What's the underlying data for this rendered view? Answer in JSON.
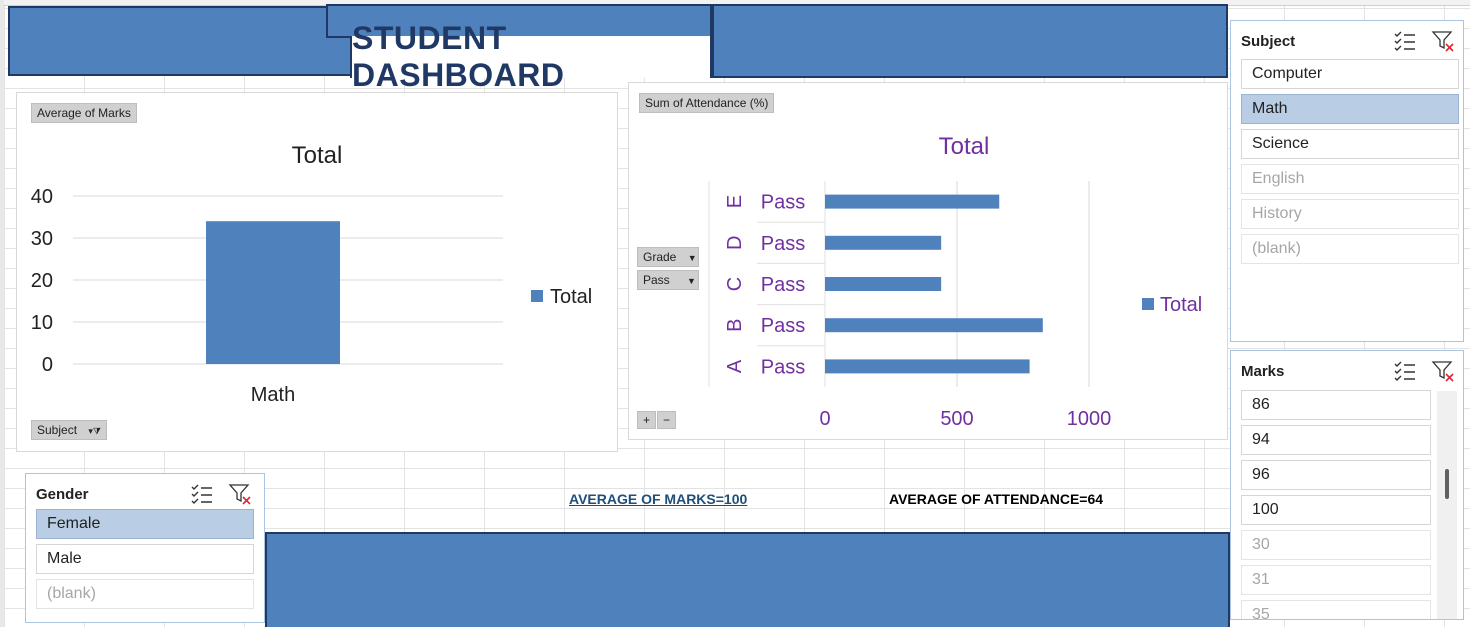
{
  "dashboard": {
    "title": "STUDENT DASHBOARD",
    "avg_marks_label": "AVERAGE OF MARKS=100",
    "avg_attendance_label": "AVERAGE OF ATTENDANCE=64"
  },
  "colors": {
    "banner": "#4f81bd",
    "banner_border": "#1f3864",
    "bar": "#4f81bd",
    "purple_text": "#7030a0",
    "slicer_selected": "#b9cde5"
  },
  "chart_data": [
    {
      "type": "bar",
      "field_button": "Average of Marks",
      "axis_field_button": "Subject",
      "title": "Total",
      "categories": [
        "Math"
      ],
      "series": [
        {
          "name": "Total",
          "values": [
            34
          ]
        }
      ],
      "ylim": [
        0,
        40
      ],
      "yticks": [
        0,
        10,
        20,
        30,
        40
      ],
      "grid": true,
      "legend": "right"
    },
    {
      "type": "bar",
      "orientation": "horizontal",
      "field_button": "Sum of Attendance (%)",
      "row_field_buttons": [
        "Grade",
        "Pass"
      ],
      "title": "Total",
      "categories": [
        {
          "grade": "E",
          "pass": "Pass"
        },
        {
          "grade": "D",
          "pass": "Pass"
        },
        {
          "grade": "C",
          "pass": "Pass"
        },
        {
          "grade": "B",
          "pass": "Pass"
        },
        {
          "grade": "A",
          "pass": "Pass"
        }
      ],
      "series": [
        {
          "name": "Total",
          "values": [
            660,
            440,
            440,
            825,
            775
          ]
        }
      ],
      "xlim": [
        0,
        1000
      ],
      "xticks": [
        0,
        500,
        1000
      ],
      "grid": true,
      "legend": "right",
      "expand_buttons": [
        "+",
        "−"
      ]
    }
  ],
  "slicers": {
    "subject": {
      "title": "Subject",
      "items": [
        {
          "label": "Computer",
          "state": "normal"
        },
        {
          "label": "Math",
          "state": "selected"
        },
        {
          "label": "Science",
          "state": "normal"
        },
        {
          "label": "English",
          "state": "dim"
        },
        {
          "label": "History",
          "state": "dim"
        },
        {
          "label": "(blank)",
          "state": "dim"
        }
      ]
    },
    "marks": {
      "title": "Marks",
      "items": [
        {
          "label": "86",
          "state": "normal"
        },
        {
          "label": "94",
          "state": "normal"
        },
        {
          "label": "96",
          "state": "normal"
        },
        {
          "label": "100",
          "state": "normal"
        },
        {
          "label": "30",
          "state": "dim"
        },
        {
          "label": "31",
          "state": "dim"
        },
        {
          "label": "35",
          "state": "dim"
        }
      ]
    },
    "gender": {
      "title": "Gender",
      "items": [
        {
          "label": "Female",
          "state": "selected"
        },
        {
          "label": "Male",
          "state": "normal"
        },
        {
          "label": "(blank)",
          "state": "dim"
        }
      ]
    }
  }
}
